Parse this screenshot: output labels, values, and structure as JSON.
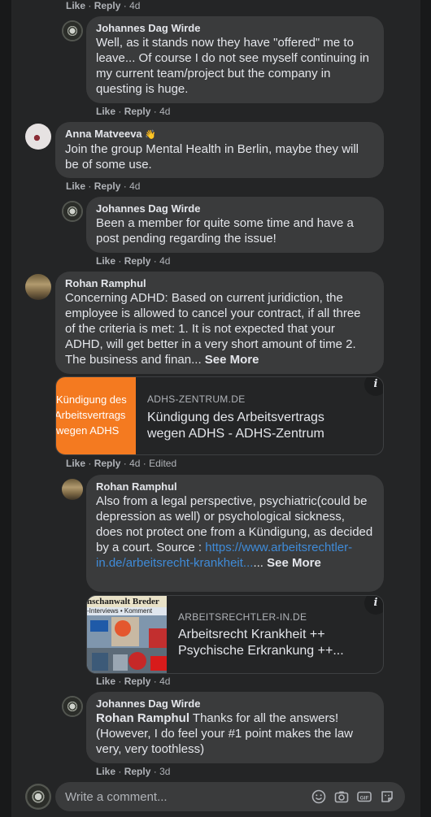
{
  "comments": [
    {
      "author": "",
      "actions": {
        "like": "Like",
        "reply": "Reply",
        "time": "4d"
      }
    },
    {
      "author": "Johannes Dag Wirde",
      "text": "Well, as it stands now they have \"offered\" me to leave... Of course I do not see myself continuing in my current team/project but the company in questing is huge.",
      "actions": {
        "like": "Like",
        "reply": "Reply",
        "time": "4d"
      }
    },
    {
      "author": "Anna Matveeva",
      "author_badge": "👋",
      "text": "Join the group Mental Health in Berlin, maybe they will be of some use.",
      "actions": {
        "like": "Like",
        "reply": "Reply",
        "time": "4d"
      }
    },
    {
      "author": "Johannes Dag Wirde",
      "text": "Been a member for quite some time and have a post pending regarding the issue!",
      "actions": {
        "like": "Like",
        "reply": "Reply",
        "time": "4d"
      }
    },
    {
      "author": "Rohan Ramphul",
      "text": "Concerning ADHD: Based on current juridiction, the employee is allowed to cancel your contract, if all three of the criteria is met: 1. It is not expected that your ADHD, will get better in a very short amount of time 2. The business and finan...",
      "see_more": "See More",
      "card": {
        "thumb_lines": [
          "Kündigung des",
          "Arbeitsvertrags",
          "wegen ADHS"
        ],
        "domain": "ADHS-ZENTRUM.DE",
        "title": "Kündigung des Arbeitsvertrags wegen ADHS - ADHS-Zentrum"
      },
      "actions": {
        "like": "Like",
        "reply": "Reply",
        "time": "4d",
        "edited": "Edited"
      }
    },
    {
      "author": "Rohan Ramphul",
      "text": "Also from a legal perspective, psychiatric(could be depression as well) or psychological sickness, does not protect one from a Kündigung, as decided by a court. Source :",
      "link": "https://www.arbeitsrechtler-in.de/arbeitsrecht-krankheit...",
      "see_more": "See More",
      "card": {
        "thumb_top": "nschanwalt Breder",
        "thumb_sub": "-Interviews • Komment",
        "domain": "ARBEITSRECHTLER-IN.DE",
        "title": "Arbeitsrecht Krankheit ++ Psychische Erkrankung ++..."
      },
      "actions": {
        "like": "Like",
        "reply": "Reply",
        "time": "4d"
      }
    },
    {
      "author": "Johannes Dag Wirde",
      "mention": "Rohan Ramphul",
      "text": "Thanks for all the answers! (However, I do feel your #1 point makes the law very, very toothless)",
      "actions": {
        "like": "Like",
        "reply": "Reply",
        "time": "3d"
      }
    }
  ],
  "composer": {
    "placeholder": "Write a comment...",
    "icons": [
      "emoji-icon",
      "camera-icon",
      "gif-icon",
      "sticker-icon"
    ]
  },
  "info_glyph": "i",
  "sep": "·",
  "ellipsis": "..."
}
